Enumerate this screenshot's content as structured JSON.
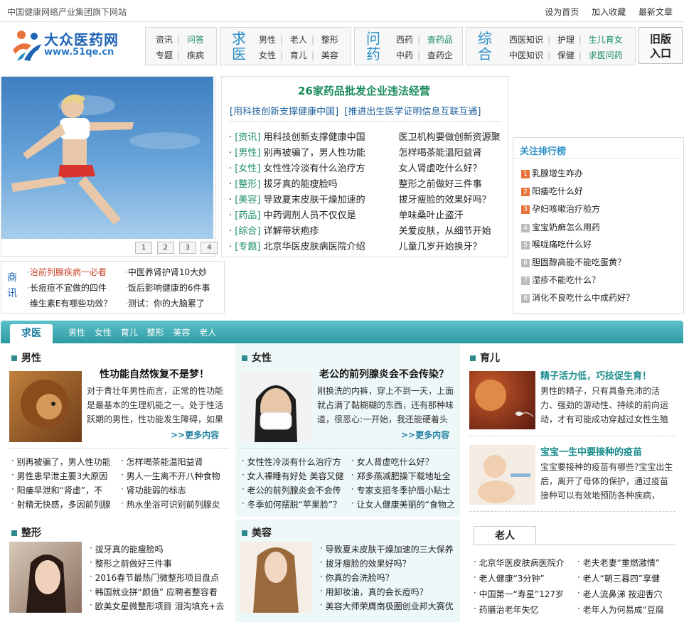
{
  "topbar": {
    "site_note": "中国健康网络产业集团旗下网站",
    "links": [
      "设为首页",
      "加入收藏",
      "最新文章"
    ]
  },
  "logo": {
    "name": "大众医药网",
    "url": "www.51qe.cn"
  },
  "nav": {
    "group1": {
      "row1": [
        "资讯",
        "问答"
      ],
      "row2": [
        "专题",
        "疾病"
      ]
    },
    "group2": {
      "big": "求医",
      "row1": [
        "男性",
        "老人",
        "整形"
      ],
      "row2": [
        "女性",
        "育儿",
        "美容"
      ]
    },
    "group3": {
      "big": "问药",
      "row1": [
        "西药",
        "查药品"
      ],
      "row2": [
        "中药",
        "查药企"
      ]
    },
    "group4": {
      "big": "综合",
      "row1": [
        "西医知识",
        "护理",
        "生儿育女"
      ],
      "row2": [
        "中医知识",
        "保健",
        "求医问药"
      ]
    },
    "old_version": [
      "旧版",
      "入口"
    ]
  },
  "hero": {
    "pages": [
      "1",
      "2",
      "3",
      "4"
    ]
  },
  "news": {
    "headline": "26家药品批发企业违法经营",
    "subhead_left": "[用科技创新支撑健康中国]",
    "subhead_right": "[推进出生医学证明信息互联互通]",
    "rows": [
      {
        "tag": "[资讯]",
        "left": "用科技创新支撑健康中国",
        "right": "医卫机构要做创新资源聚"
      },
      {
        "tag": "[男性]",
        "left": "别再被骗了，男人性功能",
        "right": "怎样喝茶能温阳益肾"
      },
      {
        "tag": "[女性]",
        "left": "女性性冷淡有什么治疗方",
        "right": "女人肾虚吃什么好？"
      },
      {
        "tag": "[整形]",
        "left": "拔牙真的能瘦脸吗",
        "right": "整形之前做好三件事"
      },
      {
        "tag": "[美容]",
        "left": "导致夏末皮肤干燥加速的",
        "right": "拔牙瘦脸的效果好吗？"
      },
      {
        "tag": "[药品]",
        "left": "中药调剂人员不仅仅是",
        "right": "单味桑叶止盗汗"
      },
      {
        "tag": "[综合]",
        "left": "详解带状疱疹",
        "right": "关爱皮肤，从细节开始"
      },
      {
        "tag": "[专题]",
        "left": "北京华医皮肤病医院介绍",
        "right": "儿童几岁开始换牙？"
      }
    ]
  },
  "rank": {
    "title": "关注排行榜",
    "items": [
      {
        "n": "1",
        "text": "乳腺增生咋办"
      },
      {
        "n": "2",
        "text": "阳痿吃什么好"
      },
      {
        "n": "3",
        "text": "孕妇咳嗽治疗验方"
      },
      {
        "n": "4",
        "text": "宝宝奶癣怎么用药"
      },
      {
        "n": "5",
        "text": "喉咙痛吃什么好"
      },
      {
        "n": "6",
        "text": "胆固醇高能不能吃蛋黄？"
      },
      {
        "n": "7",
        "text": "湿疹不能吃什么？"
      },
      {
        "n": "8",
        "text": "消化不良吃什么中成药好？"
      }
    ]
  },
  "biz": {
    "label": "商讯",
    "left": [
      "治前列腺疾病一必看",
      "长痘痘不宜做的四件",
      "维生素E有哪些功效？"
    ],
    "right": [
      "中医养肾护肾10大妙",
      "饭后影响健康的6件事",
      "测试：你的大脑累了"
    ]
  },
  "section": {
    "tab": "求医",
    "links": [
      "男性",
      "女性",
      "育儿",
      "整形",
      "美容",
      "老人"
    ]
  },
  "male": {
    "title": "男性",
    "headline": "性功能自然恢复不是梦！",
    "body": "对于青壮年男性而言，正常的性功能是最基本的生理机能之一。处于性活跃期的男性，性功能发生障碍，如果",
    "more": ">>更多内容",
    "list_left": [
      "别再被骗了，男人性功能",
      "男性患早泄主要3大原因",
      "阳痿早泄和“肾虚”，不",
      "射精无快感，多因前列腺"
    ],
    "list_right": [
      "怎样喝茶能温阳益肾",
      "男人一生离不开八种食物",
      "肾功能弱的标志",
      "热水坐浴可识别前列腺炎"
    ]
  },
  "female": {
    "title": "女性",
    "headline": "老公的前列腺炎会不会传染？",
    "body": "刚换洗的内裤，穿上不到一天，上面就占满了黏糊糊的东西，还有那种味道，很恶心:一开始，我还能硬着头皮",
    "more": ">>更多内容",
    "list_left": [
      "女性性冷淡有什么治疗方",
      "女人裸睡有好处 美容又健",
      "老公的前列腺炎会不会传",
      "冬季如何摆脱“苹果脸”？"
    ],
    "list_right": [
      "女人肾虚吃什么好？",
      "郑多燕减肥操下载地址全",
      "专家支招冬季护唇小贴士",
      "让女人健康美丽的“食物之"
    ]
  },
  "child": {
    "title": "育儿",
    "a1_headline": "精子活力低，巧技促生育！",
    "a1_body": "男性的精子，只有具备充沛的活力、强劲的游动性、持续的前向运动，才有可能成功穿越过女性生殖",
    "a2_headline": "宝宝一生中要接种的疫苗",
    "a2_body": "宝宝要接种的疫苗有哪些?宝宝出生后，离开了母体的保护，通过疫苗接种可以有效地预防各种疾病，"
  },
  "plastic": {
    "title": "整形",
    "list": [
      "拔牙真的能瘦脸吗",
      "整形之前做好三件事",
      "2016春节最热门微整形项目盘点",
      "韩国就业拼“颜值” 应聘者整容看",
      "欧美女星微整形项目 泪沟填充+去"
    ]
  },
  "beauty": {
    "title": "美容",
    "list": [
      "导致夏末皮肤干燥加速的三大保养",
      "拔牙瘦脸的效果好吗？",
      "你真的会洗脸吗？",
      "用卸妆油，真的会长痘吗？",
      "美容大师荣膺南极圈创业邦大赛优"
    ]
  },
  "elder": {
    "tab": "老人",
    "list_left": [
      "北京华医皮肤病医院介",
      "老人健康“3分钟”",
      "中国第一“寿星”127岁",
      "药膳治老年失忆"
    ],
    "list_right": [
      "老夫老妻“重燃激情”",
      "老人“朝三暮四”享健",
      "老人流鼻涕 按迎香穴",
      "老年人为何易成“豆腐"
    ]
  },
  "colors": {
    "accent": "#2a8fc7",
    "green": "#1a8c5a",
    "teal": "#2e9aa4",
    "hot": "#e8733a"
  },
  "icons": [
    "logo-people-icon",
    "square-bullet-icon",
    "rank-number-icon"
  ]
}
